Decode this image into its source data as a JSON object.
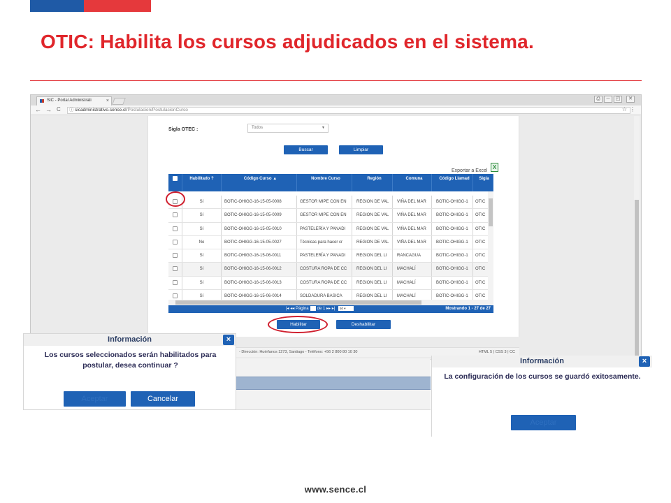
{
  "slide": {
    "title": "OTIC: Habilita los cursos adjudicados en el sistema.",
    "footer_url": "www.sence.cl",
    "colors": {
      "accent_red": "#e0262b",
      "brand_blue": "#1f5aa6"
    }
  },
  "browser": {
    "tab_title": "SIC - Portal Administrati",
    "tab_close": "×",
    "nav": {
      "back": "←",
      "forward": "→",
      "reload": "C",
      "info_icon": "ⓘ"
    },
    "url_host": "sicadministrativo.sence.cl",
    "url_path": "/Postulacion/PostulacionCurso",
    "star": "☆",
    "menu": "⋮",
    "window_controls": [
      "⎙",
      "─",
      "◰",
      "✕"
    ]
  },
  "filters": {
    "sigla_label": "Sigla OTEC :",
    "sigla_value": "Todos",
    "buscar_label": "Buscar",
    "limpiar_label": "Limpiar"
  },
  "export": {
    "label": "Exportar a Excel",
    "icon": "excel-icon"
  },
  "grid": {
    "columns": [
      "Habilitado ?",
      "Código Curso ▲",
      "Nombre Curso",
      "Región",
      "Comuna",
      "Código Llamad",
      "Sigla"
    ],
    "rows": [
      [
        "Sí",
        "BOTIC-OHIGG-16-15-05-0008",
        "GESTOR MIPE CON EN",
        "REGION DE VAL",
        "VIÑA DEL MAR",
        "BOTIC-OHIGG-1",
        "OTIC"
      ],
      [
        "Sí",
        "BOTIC-OHIGG-16-15-05-0009",
        "GESTOR MIPE CON EN",
        "REGION DE VAL",
        "VIÑA DEL MAR",
        "BOTIC-OHIGG-1",
        "OTIC"
      ],
      [
        "Sí",
        "BOTIC-OHIGG-16-15-05-0010",
        "PASTELERÍA Y PANADI",
        "REGION DE VAL",
        "VIÑA DEL MAR",
        "BOTIC-OHIGG-1",
        "OTIC"
      ],
      [
        "No",
        "BOTIC-OHIGG-16-15-05-0027",
        "Técnicas para hacer cr",
        "REGION DE VAL",
        "VIÑA DEL MAR",
        "BOTIC-OHIGG-1",
        "OTIC"
      ],
      [
        "Sí",
        "BOTIC-OHIGG-16-15-06-0011",
        "PASTELERÍA Y PANADI",
        "REGION DEL LI",
        "RANCAGUA",
        "BOTIC-OHIGG-1",
        "OTIC"
      ],
      [
        "Sí",
        "BOTIC-OHIGG-16-15-06-0012",
        "COSTURA ROPA DE CC",
        "REGION DEL LI",
        "MACHALÍ",
        "BOTIC-OHIGG-1",
        "OTIC"
      ],
      [
        "Sí",
        "BOTIC-OHIGG-16-15-06-0013",
        "COSTURA ROPA DE CC",
        "REGION DEL LI",
        "MACHALÍ",
        "BOTIC-OHIGG-1",
        "OTIC"
      ],
      [
        "Sí",
        "BOTIC-OHIGG-16-15-06-0014",
        "SOLDADURA BASICA",
        "REGION DEL LI",
        "MACHALÍ",
        "BOTIC-OHIGG-1",
        "OTIC"
      ]
    ],
    "pager": {
      "first": "|◂",
      "prev": "◂◂",
      "page_label": "Página",
      "of_label": "de 1",
      "next": "▸▸",
      "last": "▸|",
      "page_size": "50 ▾",
      "showing": "Mostrando 1 - 27 de 27"
    }
  },
  "actions": {
    "habilitar_label": "Habilitar",
    "deshabilitar_label": "Deshabilitar"
  },
  "page_footer": {
    "address": "- Dirección: Huérfanos 1273, Santiago - Teléfono: +56 2 800 80 10 30",
    "standards": "HTML 5 | CSS 3 | CC"
  },
  "dialog_confirm": {
    "title": "Información",
    "close": "×",
    "message": "Los cursos seleccionados serán habilitados para postular, desea continuar ?",
    "accept_label": "Aceptar",
    "cancel_label": "Cancelar"
  },
  "dialog_success": {
    "title": "Información",
    "close": "×",
    "message": "La configuración de los cursos se guardó exitosamente.",
    "accept_label": "Aceptar"
  }
}
